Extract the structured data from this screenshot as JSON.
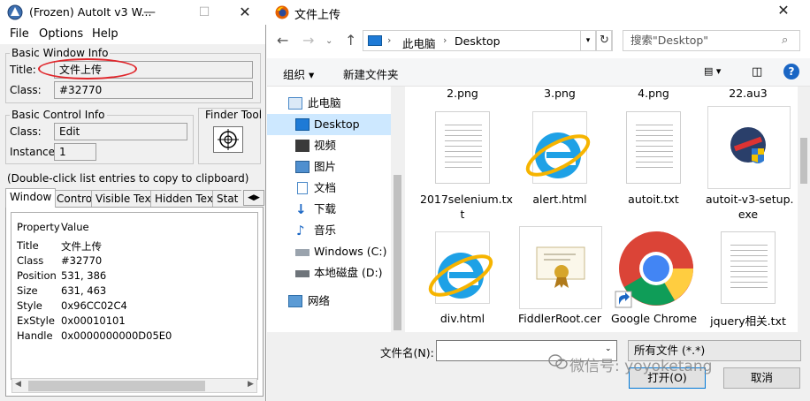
{
  "autoit": {
    "title": "(Frozen) AutoIt v3 W...",
    "menu": [
      "File",
      "Options",
      "Help"
    ],
    "basic_window": {
      "group_label": "Basic Window Info",
      "title_label": "Title:",
      "title_value": "文件上传",
      "class_label": "Class:",
      "class_value": "#32770"
    },
    "basic_control": {
      "group_label": "Basic Control Info",
      "class_label": "Class:",
      "class_value": "Edit",
      "instance_label": "Instance:",
      "instance_value": "1"
    },
    "finder_tool_label": "Finder Tool",
    "hint": "(Double-click list entries to copy to clipboard)",
    "tabs": [
      "Window",
      "Control",
      "Visible Text",
      "Hidden Text",
      "Stat"
    ],
    "props_header": {
      "property": "Property",
      "value": "Value"
    },
    "props": [
      {
        "property": "Title",
        "value": "文件上传"
      },
      {
        "property": "Class",
        "value": "#32770"
      },
      {
        "property": "Position",
        "value": "531, 386"
      },
      {
        "property": "Size",
        "value": "631, 463"
      },
      {
        "property": "Style",
        "value": "0x96CC02C4"
      },
      {
        "property": "ExStyle",
        "value": "0x00010101"
      },
      {
        "property": "Handle",
        "value": "0x0000000000D05E0"
      }
    ]
  },
  "dialog": {
    "title": "文件上传",
    "breadcrumb": [
      "此电脑",
      "Desktop"
    ],
    "search_placeholder": "搜索\"Desktop\"",
    "toolbar": {
      "organize": "组织 ▾",
      "new_folder": "新建文件夹"
    },
    "nav": [
      {
        "label": "此电脑",
        "icon": "computer-icon"
      },
      {
        "label": "Desktop",
        "icon": "desktop-icon",
        "selected": true
      },
      {
        "label": "视频",
        "icon": "video-icon"
      },
      {
        "label": "图片",
        "icon": "pictures-icon"
      },
      {
        "label": "文档",
        "icon": "documents-icon"
      },
      {
        "label": "下载",
        "icon": "downloads-icon"
      },
      {
        "label": "音乐",
        "icon": "music-icon"
      },
      {
        "label": "Windows (C:)",
        "icon": "drive-icon"
      },
      {
        "label": "本地磁盘 (D:)",
        "icon": "disk-icon"
      },
      {
        "label": "网络",
        "icon": "network-icon"
      }
    ],
    "top_row": [
      "2.png",
      "3.png",
      "4.png",
      "22.au3"
    ],
    "files": [
      {
        "line1": "2017selenium.tx",
        "line2": "t",
        "kind": "text"
      },
      {
        "line1": "alert.html",
        "line2": "",
        "kind": "ie"
      },
      {
        "line1": "autoit.txt",
        "line2": "",
        "kind": "text"
      },
      {
        "line1": "autoit-v3-setup.",
        "line2": "exe",
        "kind": "setup"
      },
      {
        "line1": "div.html",
        "line2": "",
        "kind": "ie"
      },
      {
        "line1": "FiddlerRoot.cer",
        "line2": "",
        "kind": "cert"
      },
      {
        "line1": "Google Chrome",
        "line2": "",
        "kind": "chrome"
      },
      {
        "line1": "jquery相关.txt",
        "line2": "",
        "kind": "text"
      }
    ],
    "filename_label": "文件名(N):",
    "filename_value": "",
    "filetype": "所有文件 (*.*)",
    "open_button": "打开(O)",
    "cancel_button": "取消",
    "watermark": "微信号: yoyoketang"
  }
}
